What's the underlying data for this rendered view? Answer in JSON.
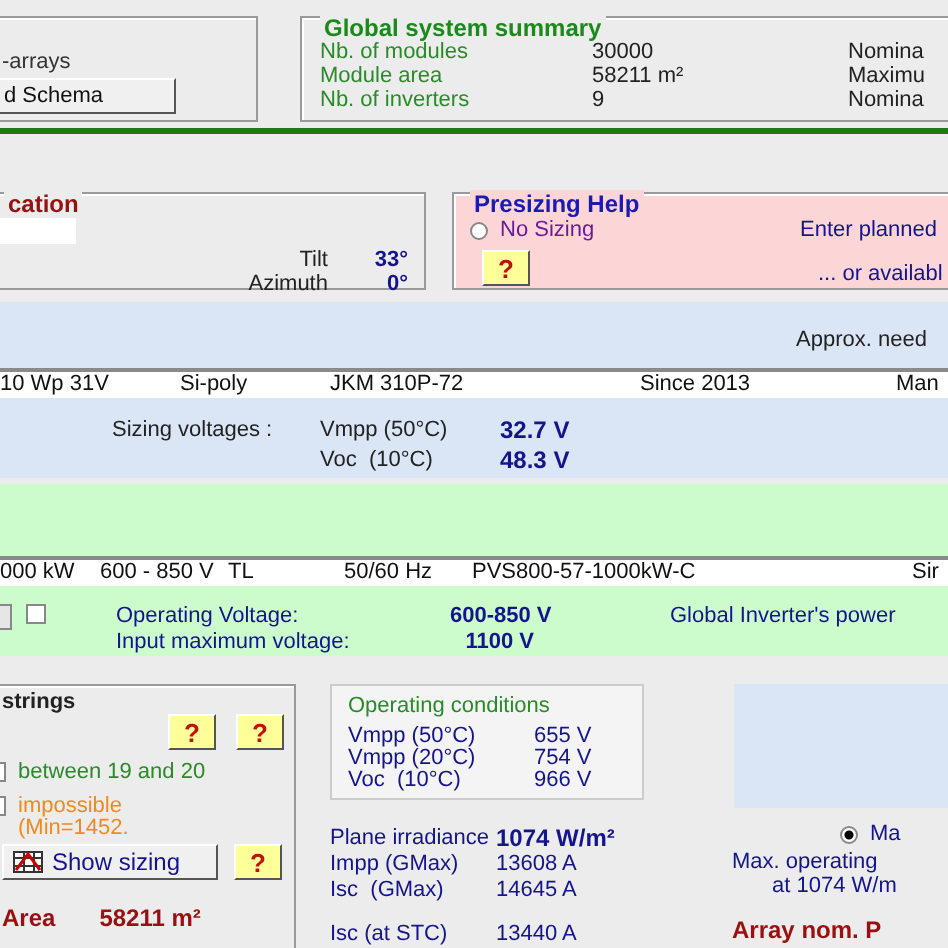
{
  "arrays_panel": {
    "label": "-arrays",
    "button": "d Schema"
  },
  "global_summary": {
    "title": "Global system summary",
    "rows": [
      {
        "label": "Nb. of modules",
        "value": "30000",
        "column_3": "Nomina"
      },
      {
        "label": "Module area",
        "value": "58211 m²",
        "column_3": "Maximu"
      },
      {
        "label": "Nb. of inverters",
        "value": "9",
        "column_3": "Nomina"
      }
    ]
  },
  "location": {
    "title": "cation",
    "fields": [
      {
        "label": "Tilt",
        "value": "33°"
      },
      {
        "label": "Azimuth",
        "value": "0°"
      }
    ]
  },
  "presizing": {
    "title": "Presizing Help",
    "radio": {
      "label": "No Sizing",
      "selected": false
    },
    "help_button": "?",
    "hints": [
      "Enter planned",
      "... or availabl"
    ]
  },
  "module": {
    "note": "Approx. need",
    "row": [
      "10 Wp 31V",
      "Si-poly",
      "JKM 310P-72",
      "Since 2013",
      "Man"
    ],
    "sizing_label": "Sizing voltages :",
    "voltages": [
      {
        "label": "Vmpp (50°C)",
        "value": "32.7",
        "unit": "V"
      },
      {
        "label": "Voc  (10°C)",
        "value": "48.3",
        "unit": "V"
      }
    ]
  },
  "inverter": {
    "row": [
      "000 kW",
      "600 - 850 V",
      "TL",
      "50/60 Hz",
      "PVS800-57-1000kW-C",
      "Sir"
    ],
    "checkbox": {
      "checked": false
    },
    "voltages": [
      {
        "label": "Operating Voltage:",
        "value": "600-850",
        "unit": "V"
      },
      {
        "label": "Input maximum voltage:",
        "value": "1100",
        "unit": "V"
      }
    ],
    "power_label": "Global Inverter's power"
  },
  "strings": {
    "title": "strings",
    "help_buttons": [
      "?",
      "?"
    ],
    "options": [
      {
        "label": "between 19 and 20",
        "checked": false,
        "kind": "ok"
      },
      {
        "label": "impossible\n(Min=1452.",
        "checked": false,
        "kind": "warning"
      }
    ],
    "show_sizing_button": "Show sizing",
    "help_button": "?",
    "area_label": "Area",
    "area_value": "58211  m²"
  },
  "operating_conditions": {
    "title": "Operating conditions",
    "rows": [
      {
        "label": "Vmpp (50°C)",
        "value": "655  V"
      },
      {
        "label": "Vmpp (20°C)",
        "value": "754  V"
      },
      {
        "label": "Voc  (10°C)",
        "value": "966  V"
      }
    ]
  },
  "array_values": [
    {
      "label": "Plane irradiance",
      "value": "1074  W/m²",
      "kind": "bold"
    },
    {
      "label": "Impp (GMax)",
      "value": "13608 A",
      "kind": "plain"
    },
    {
      "label": "Isc  (GMax)",
      "value": "14645 A",
      "kind": "plain"
    },
    {
      "label": "Isc (at STC)",
      "value": "13440 A",
      "kind": "plain"
    }
  ],
  "right_panel": {
    "radio": {
      "label": "Ma",
      "selected": true
    },
    "lines": [
      "Max. operating",
      "at 1074 W/m"
    ],
    "array_label": "Array nom. P"
  }
}
